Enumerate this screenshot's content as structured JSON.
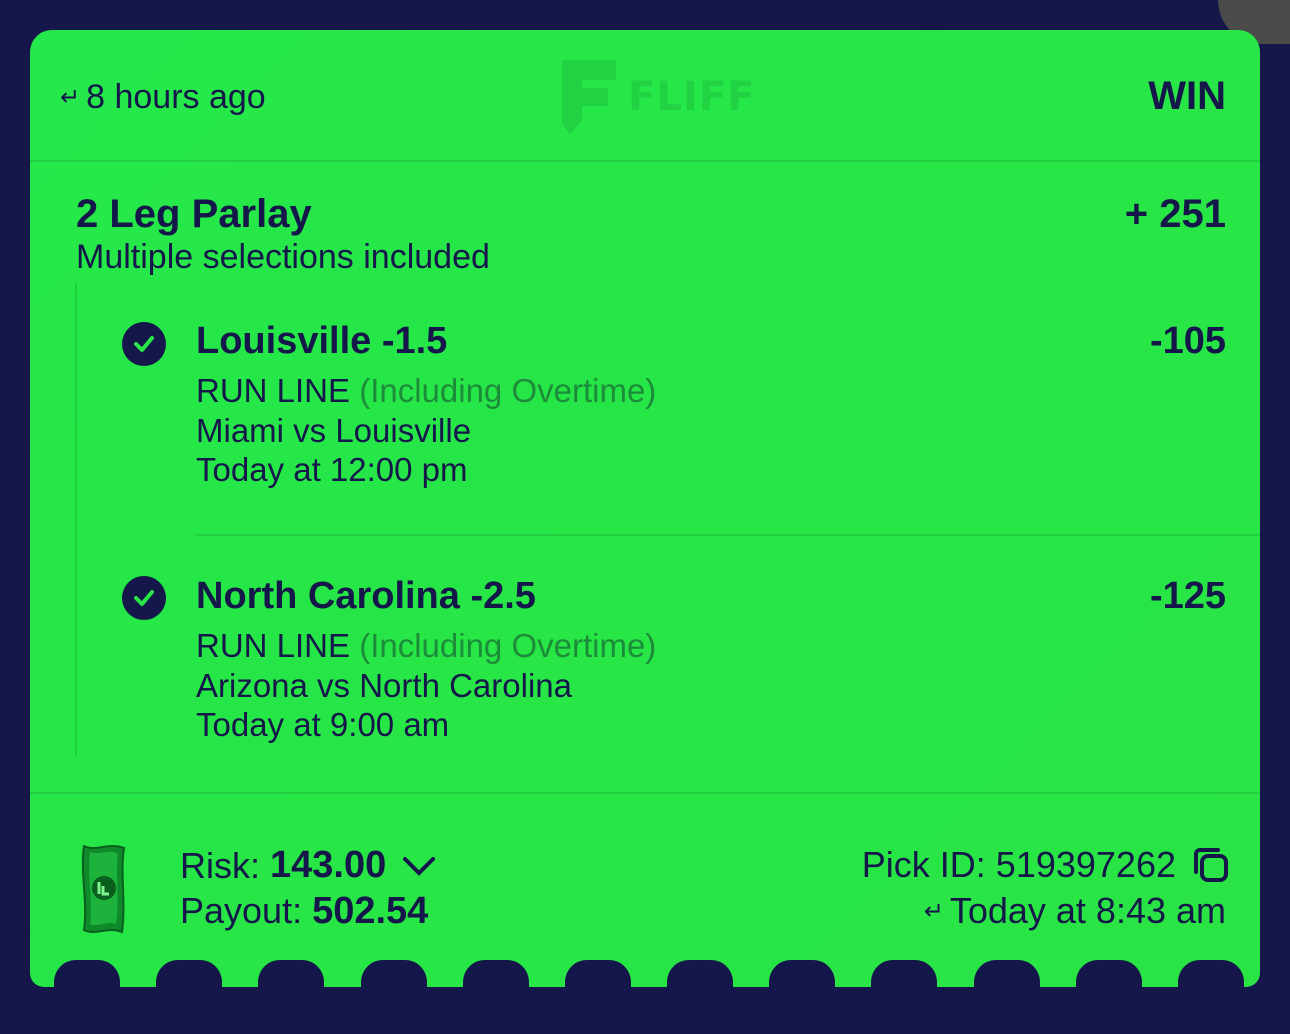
{
  "header": {
    "time_ago": "8 hours ago",
    "logo_text": "FLIFF",
    "result": "WIN"
  },
  "parlay": {
    "title": "2 Leg Parlay",
    "subtitle": "Multiple selections included",
    "odds": "+ 251"
  },
  "legs": [
    {
      "name": "Louisville -1.5",
      "odds": "-105",
      "market": "RUN LINE",
      "market_note": "(Including Overtime)",
      "matchup": "Miami vs Louisville",
      "time": "Today at 12:00 pm",
      "status_icon": "check-circle-icon"
    },
    {
      "name": "North Carolina -2.5",
      "odds": "-125",
      "market": "RUN LINE",
      "market_note": "(Including Overtime)",
      "matchup": "Arizona vs North Carolina",
      "time": "Today at 9:00 am",
      "status_icon": "check-circle-icon"
    }
  ],
  "footer": {
    "risk_label": "Risk:",
    "risk_value": "143.00",
    "payout_label": "Payout:",
    "payout_value": "502.54",
    "pick_id_label": "Pick ID:",
    "pick_id_value": "519397262",
    "placed_time": "Today at 8:43 am"
  },
  "colors": {
    "ticket_green": "#27e646",
    "navy": "#15164a",
    "muted_green": "#1d8c3a"
  }
}
